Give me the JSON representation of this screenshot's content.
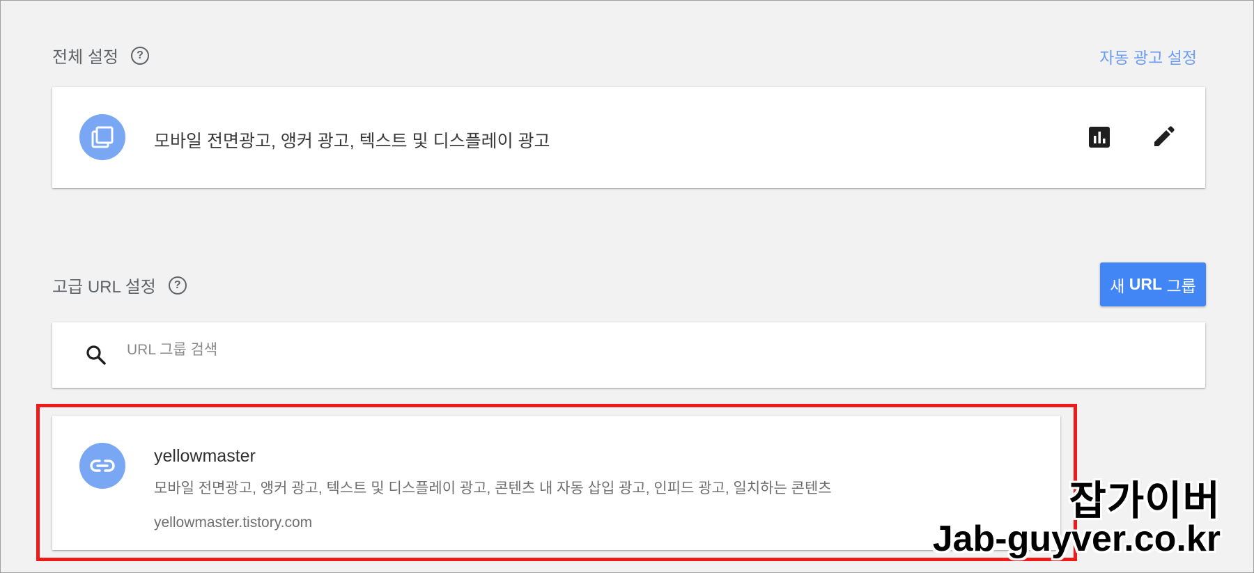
{
  "overall": {
    "title": "전체 설정",
    "help_icon": "help-circle-icon",
    "auto_ads_link": "자동 광고 설정",
    "card": {
      "icon": "layers-icon",
      "text": "모바일 전면광고, 앵커 광고, 텍스트 및 디스플레이 광고",
      "report_icon": "bar-chart-icon",
      "edit_icon": "edit-pencil-icon"
    }
  },
  "advanced": {
    "title": "고급 URL 설정",
    "help_icon": "help-circle-icon",
    "new_group_prefix": "새 ",
    "new_group_bold": "URL",
    "new_group_suffix": " 그룹",
    "search": {
      "icon": "search-icon",
      "placeholder": "URL 그룹 검색",
      "value": ""
    },
    "groups": [
      {
        "icon": "link-icon",
        "name": "yellowmaster",
        "formats": "모바일 전면광고, 앵커 광고, 텍스트 및 디스플레이 광고, 콘텐츠 내 자동 삽입 광고, 인피드 광고, 일치하는 콘텐츠",
        "url": "yellowmaster.tistory.com"
      }
    ]
  },
  "highlight_color": "#ee1b1b",
  "accent_color": "#4285f4",
  "watermark": {
    "line1": "잡가이버",
    "line2": "Jab-guyver.co.kr"
  }
}
